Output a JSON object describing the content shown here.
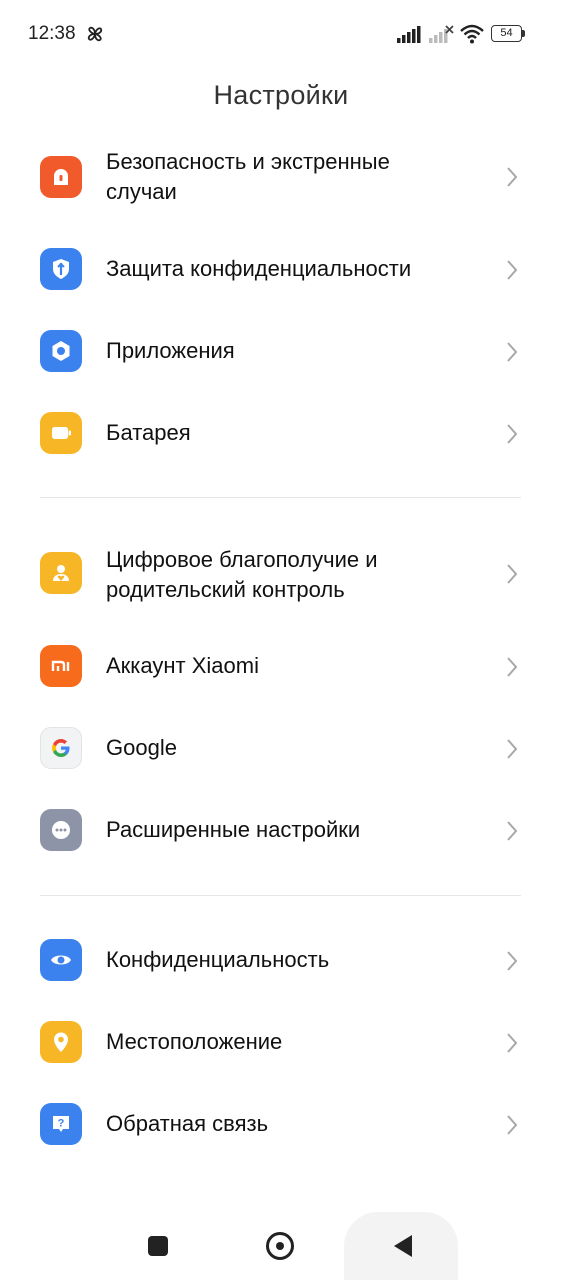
{
  "status_bar": {
    "time": "12:38",
    "battery": "54",
    "icons": [
      "pinwheel-icon",
      "signal-icon",
      "signal-x-icon",
      "wifi-icon",
      "battery-icon"
    ]
  },
  "header": {
    "title": "Настройки"
  },
  "groups": [
    {
      "items": [
        {
          "label_lines": [
            "Безопасность и экстренные",
            "случаи"
          ],
          "icon": "emergency-icon",
          "color": "#F15A2B"
        },
        {
          "label": "Защита конфиденциальности",
          "icon": "privacy-shield-icon",
          "color": "#3C82EE"
        },
        {
          "label": "Приложения",
          "icon": "apps-gear-icon",
          "color": "#3C82EE"
        },
        {
          "label": "Батарея",
          "icon": "battery-icon",
          "color": "#F6B626"
        }
      ]
    },
    {
      "items": [
        {
          "label_lines": [
            "Цифровое благополучие и",
            "родительский контроль"
          ],
          "icon": "wellbeing-icon",
          "color": "#F6B626"
        },
        {
          "label": "Аккаунт Xiaomi",
          "icon": "xiaomi-logo-icon",
          "color": "#F76B1C"
        },
        {
          "label": "Google",
          "icon": "google-logo-icon",
          "color": "#F1F3F4"
        },
        {
          "label": "Расширенные настройки",
          "icon": "more-dots-icon",
          "color": "#8E94A8"
        }
      ]
    },
    {
      "items": [
        {
          "label": "Конфиденциальность",
          "icon": "eye-icon",
          "color": "#3C82EE"
        },
        {
          "label": "Местоположение",
          "icon": "location-pin-icon",
          "color": "#F6B626"
        },
        {
          "label": "Обратная связь",
          "icon": "feedback-icon",
          "color": "#3C82EE"
        }
      ]
    }
  ],
  "nav_bar": {
    "icons": [
      "recents-square-icon",
      "home-circle-icon",
      "back-triangle-icon"
    ]
  }
}
